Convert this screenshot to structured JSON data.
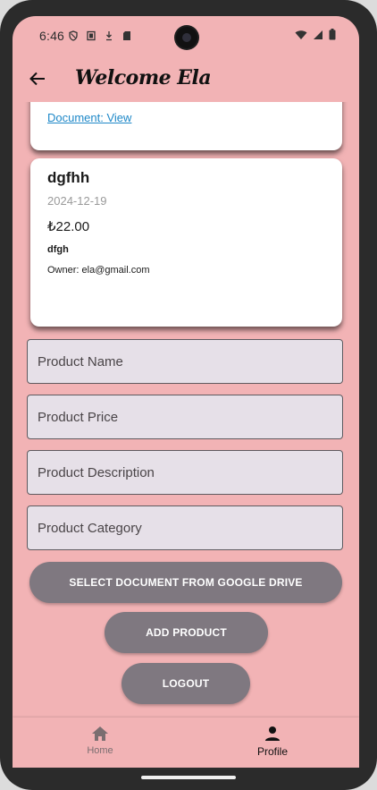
{
  "status_bar": {
    "time": "6:46",
    "left_icons": [
      "shield-icon",
      "screen-icon",
      "download-icon",
      "sd-card-icon"
    ],
    "right_icons": [
      "wifi-icon",
      "signal-icon",
      "battery-icon"
    ]
  },
  "app_bar": {
    "title": "Welcome Ela",
    "back_icon": "arrow-back-icon"
  },
  "previous_card": {
    "document_link": "Document: View"
  },
  "product_card": {
    "name": "dgfhh",
    "date": "2024-12-19",
    "price": "₺22.00",
    "description": "dfgh",
    "owner": "Owner: ela@gmail.com"
  },
  "form": {
    "name_placeholder": "Product Name",
    "price_placeholder": "Product Price",
    "description_placeholder": "Product Description",
    "category_placeholder": "Product Category"
  },
  "buttons": {
    "select_document": "SELECT DOCUMENT FROM GOOGLE DRIVE",
    "add_product": "ADD PRODUCT",
    "logout": "LOGOUT"
  },
  "bottom_nav": {
    "items": [
      {
        "label": "Home",
        "icon": "home-icon",
        "selected": false
      },
      {
        "label": "Profile",
        "icon": "person-icon",
        "selected": true
      }
    ]
  },
  "colors": {
    "background": "#f2b3b5",
    "button": "#7f7880",
    "link": "#1e88c8",
    "field": "#e6e0e8"
  }
}
